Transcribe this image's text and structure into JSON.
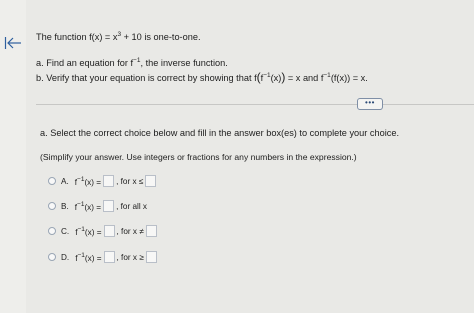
{
  "problem": {
    "statement_prefix": "The function f(x) = x",
    "statement_exp": "3",
    "statement_suffix": " + 10 is one-to-one.",
    "part_a_prefix": "a. Find an equation for f",
    "part_a_exp": "−1",
    "part_a_suffix": ", the inverse function.",
    "part_b_text1": "b. Verify that your equation is correct by showing that f",
    "part_b_paren_open": "(",
    "part_b_text2": "f",
    "part_b_exp1": "−1",
    "part_b_text3": "(x)",
    "part_b_paren_close": ")",
    "part_b_text4": " = x and f",
    "part_b_exp2": "−1",
    "part_b_text5": "(f(x)) = x."
  },
  "more_button_label": "•••",
  "answer_section": {
    "instruction": "a. Select the correct choice below and fill in the answer box(es) to complete your choice.",
    "note": "(Simplify your answer. Use integers or fractions for any numbers in the expression.)"
  },
  "choices": [
    {
      "letter": "A.",
      "f": "f",
      "exp": "−1",
      "arg": "(x) =",
      "condition": ", for x ≤"
    },
    {
      "letter": "B.",
      "f": "f",
      "exp": "−1",
      "arg": "(x) =",
      "condition": ", for all x"
    },
    {
      "letter": "C.",
      "f": "f",
      "exp": "−1",
      "arg": "(x) =",
      "condition": ", for x ≠"
    },
    {
      "letter": "D.",
      "f": "f",
      "exp": "−1",
      "arg": "(x) =",
      "condition": ", for x ≥"
    }
  ],
  "icons": {
    "back": "back-arrow-icon"
  }
}
